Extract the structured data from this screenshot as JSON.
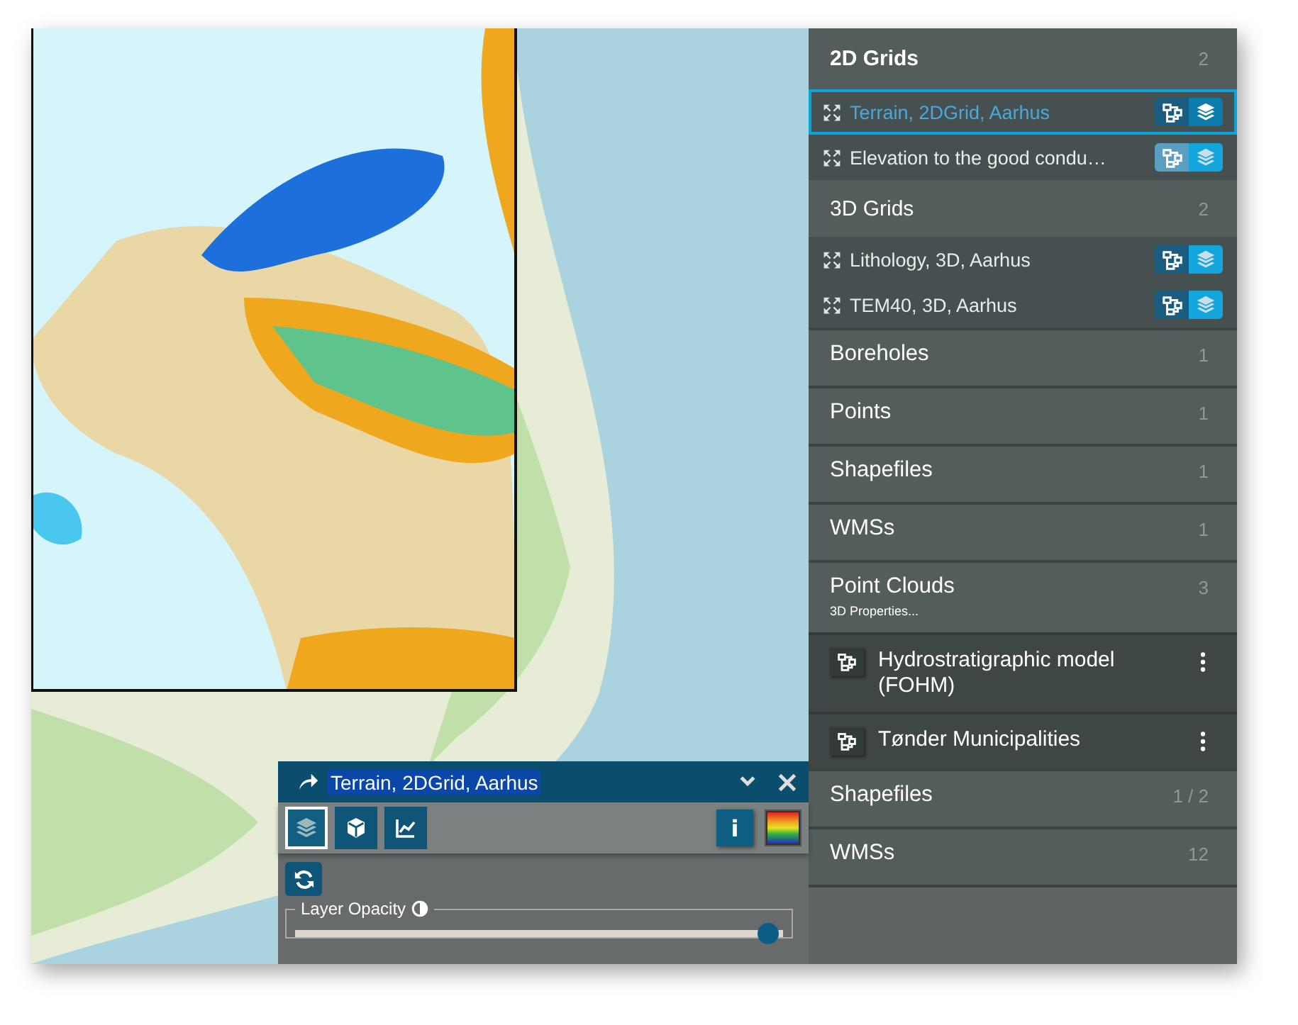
{
  "sidebar": {
    "rows": [
      {
        "kind": "header",
        "label": "2D Grids",
        "count": "2",
        "active": true
      },
      {
        "kind": "layer",
        "label": "Terrain, 2DGrid, Aarhus",
        "selected": true,
        "grid_on": true,
        "layers_on": true
      },
      {
        "kind": "layer",
        "label": "Elevation to the good condu…",
        "selected": false,
        "grid_on": false,
        "layers_on": false
      },
      {
        "kind": "header",
        "label": "3D Grids",
        "count": "2",
        "active": false
      },
      {
        "kind": "layer",
        "label": "Lithology, 3D, Aarhus",
        "selected": false,
        "grid_on": true,
        "layers_on": false
      },
      {
        "kind": "layer",
        "label": "TEM40, 3D, Aarhus",
        "selected": false,
        "grid_on": true,
        "layers_on": false
      },
      {
        "kind": "category",
        "label": "Boreholes",
        "count": "1"
      },
      {
        "kind": "category",
        "label": "Points",
        "count": "1"
      },
      {
        "kind": "category",
        "label": "Shapefiles",
        "count": "1"
      },
      {
        "kind": "category",
        "label": "WMSs",
        "count": "1"
      },
      {
        "kind": "category",
        "label": "Point Clouds",
        "count": "3",
        "subtitle": "3D Properties..."
      },
      {
        "kind": "model",
        "label": "Hydrostratigraphic model (FOHM)"
      },
      {
        "kind": "model",
        "label": "Tønder Municipalities"
      },
      {
        "kind": "category",
        "label": "Shapefiles",
        "count": "1 / 2"
      },
      {
        "kind": "category",
        "label": "WMSs",
        "count": "12"
      }
    ]
  },
  "panel": {
    "title": "Terrain, 2DGrid, Aarhus",
    "title_highlighted": true,
    "tabs": [
      {
        "kind": "layers",
        "selected": true
      },
      {
        "kind": "cube",
        "selected": false
      },
      {
        "kind": "chart",
        "selected": false
      }
    ],
    "info_label": "i",
    "opacity": {
      "label": "Layer Opacity",
      "level": 0.99
    }
  }
}
